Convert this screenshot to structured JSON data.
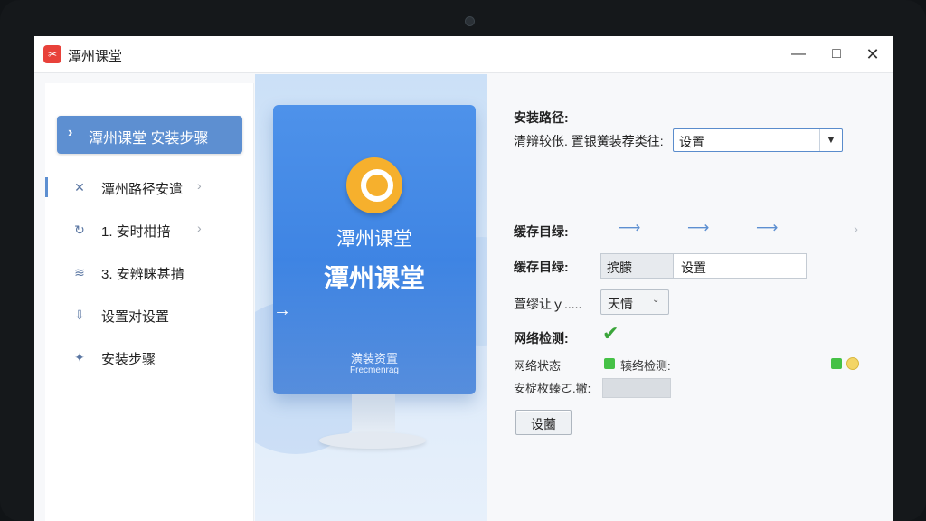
{
  "window": {
    "title": "潭州课堂",
    "logo_text": "✂",
    "controls": {
      "minimize": "—",
      "maximize": "□",
      "close": "✕"
    }
  },
  "sidebar": {
    "active_item": {
      "chevron": "›",
      "label": "潭州课堂   安装步骤"
    },
    "items": [
      {
        "label": "潭州路径安遣",
        "icon": "close-x-icon",
        "icon_glyph": "✕",
        "arrow": "›"
      },
      {
        "label": "1. 安时柑掊",
        "icon": "refresh-icon",
        "icon_glyph": "↻",
        "arrow": "›"
      },
      {
        "label": "3. 安辨睐甚掯",
        "icon": "layers-icon",
        "icon_glyph": "≋",
        "arrow": ""
      },
      {
        "label": "设置对设置",
        "icon": "download-icon",
        "icon_glyph": "⇩",
        "arrow": ""
      },
      {
        "label": "安装步骤",
        "icon": "tools-icon",
        "icon_glyph": "✦",
        "arrow": ""
      }
    ]
  },
  "preview": {
    "title_small": "潭州课堂",
    "title_large": "潭州课堂",
    "caption_cn": "潢装资置",
    "caption_en": "Frecmenrag",
    "arrow": "→"
  },
  "install": {
    "path_label": "安装路径:",
    "path_prompt": "清辩较伥. 置银黉装荐类往:",
    "path_select_value": "设置",
    "path_select_arrow": "▼",
    "cache_label_1": "缓存目绿:",
    "arrows": [
      "⟶",
      "⟶",
      "⟶",
      "›"
    ],
    "cache_label_2": "缓存目绿:",
    "cache_value_1": "摈朦",
    "cache_value_2": "设置",
    "dropdown_label": "萱缪让ｙ.....",
    "dropdown_value": "天情",
    "dropdown_arrow": "⌄",
    "network_label": "网络检测:",
    "network_check": "✔",
    "network_status_label": "网络状态",
    "network_status_detail": "辏络检测:",
    "progress_label": "安椗枚螓ㄛ.撇:",
    "progress_fraction": 0.0,
    "settings_button": "设蔨"
  },
  "colors": {
    "accent": "#5d8fd1",
    "ok_green": "#45c146",
    "warn_yellow": "#f3d566",
    "app_red": "#e8413a"
  }
}
